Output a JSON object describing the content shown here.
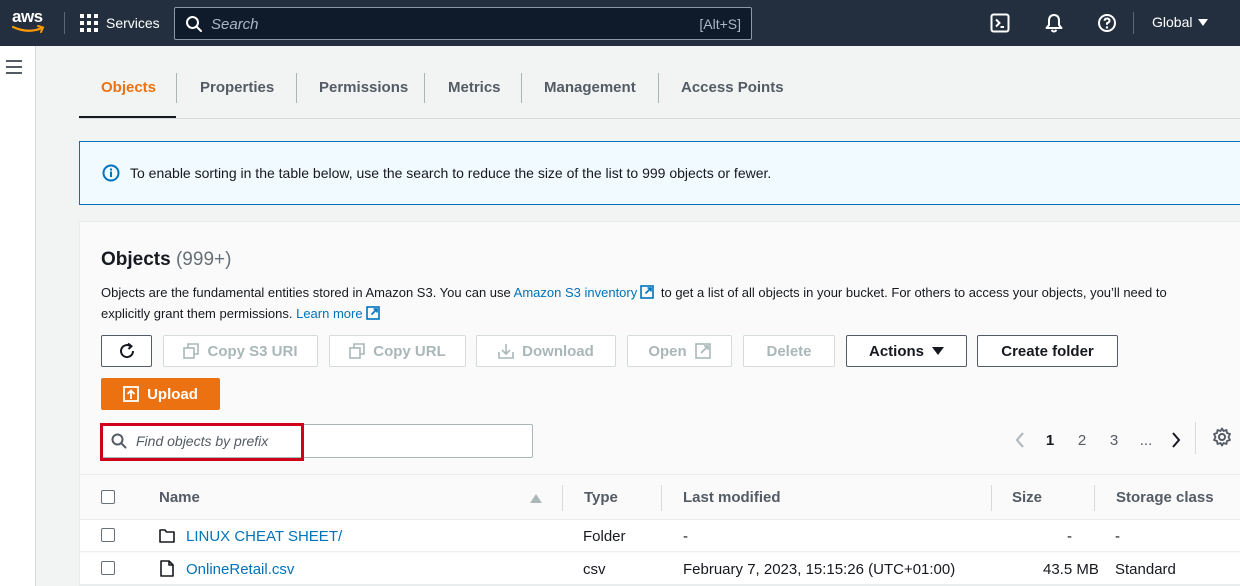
{
  "topnav": {
    "logo_text": "aws",
    "services_label": "Services",
    "search_placeholder": "Search",
    "search_shortcut": "[Alt+S]",
    "region_label": "Global",
    "icons": [
      "grid-icon",
      "cloudshell-icon",
      "bell-icon",
      "help-icon",
      "caret-down-icon"
    ]
  },
  "tabs": [
    {
      "label": "Objects",
      "active": true
    },
    {
      "label": "Properties"
    },
    {
      "label": "Permissions"
    },
    {
      "label": "Metrics"
    },
    {
      "label": "Management"
    },
    {
      "label": "Access Points"
    }
  ],
  "flash": {
    "message": "To enable sorting in the table below, use the search to reduce the size of the list to 999 objects or fewer."
  },
  "objects_panel": {
    "title": "Objects",
    "count": "(999+)",
    "desc_part1": "Objects are the fundamental entities stored in Amazon S3. You can use",
    "desc_link1": "Amazon S3 inventory",
    "desc_part2": "to get a list of all objects in your bucket. For others to access your objects, you’ll need to explicitly grant them permissions.",
    "desc_link2": "Learn more",
    "buttons": {
      "copy_s3_uri": "Copy S3 URI",
      "copy_url": "Copy URL",
      "download": "Download",
      "open": "Open",
      "delete": "Delete",
      "actions": "Actions",
      "create_folder": "Create folder",
      "upload": "Upload"
    },
    "prefix_search_placeholder": "Find objects by prefix",
    "pagination": {
      "pages": [
        "1",
        "2",
        "3",
        "..."
      ],
      "current": "1"
    }
  },
  "table": {
    "columns": [
      "Name",
      "Type",
      "Last modified",
      "Size",
      "Storage class"
    ],
    "rows": [
      {
        "name": "LINUX CHEAT SHEET/",
        "type": "Folder",
        "last_modified": "-",
        "size": "-",
        "storage_class": "-",
        "kind": "folder"
      },
      {
        "name": "OnlineRetail.csv",
        "type": "csv",
        "last_modified": "February 7, 2023, 15:15:26 (UTC+01:00)",
        "size": "43.5 MB",
        "storage_class": "Standard",
        "kind": "file"
      }
    ]
  },
  "colors": {
    "nav_bg": "#232f3e",
    "accent_orange": "#ec7211",
    "link_blue": "#0073bb",
    "highlight_red": "#d0021b"
  }
}
